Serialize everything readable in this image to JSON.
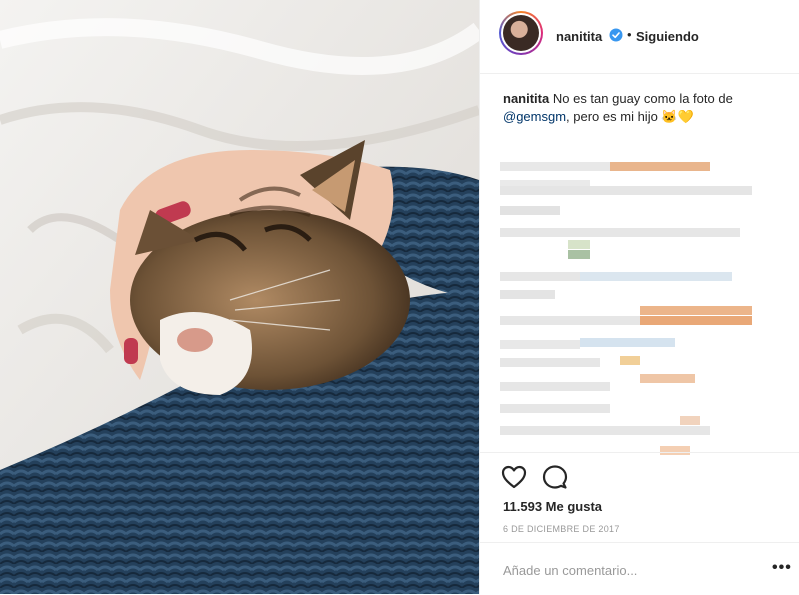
{
  "post": {
    "username": "nanitita",
    "separator": "•",
    "follow_status": "Siguiendo",
    "caption_user": "nanitita",
    "caption_text_1": "No es tan guay como la foto de",
    "caption_mention": "@gemsgm",
    "caption_text_2": ", pero es mi hijo 🐱💛",
    "likes": "11.593 Me gusta",
    "date": "6 DE DICIEMBRE DE 2017",
    "comment_placeholder": "Añade un comentario...",
    "more_label": "•••"
  },
  "icons": {
    "verified": "verified-badge-icon",
    "like": "heart-icon",
    "comment": "comment-bubble-icon",
    "more": "more-options-icon"
  },
  "colors": {
    "verified_blue": "#3897f0",
    "text": "#262626",
    "muted": "#999999",
    "mention": "#003569"
  }
}
